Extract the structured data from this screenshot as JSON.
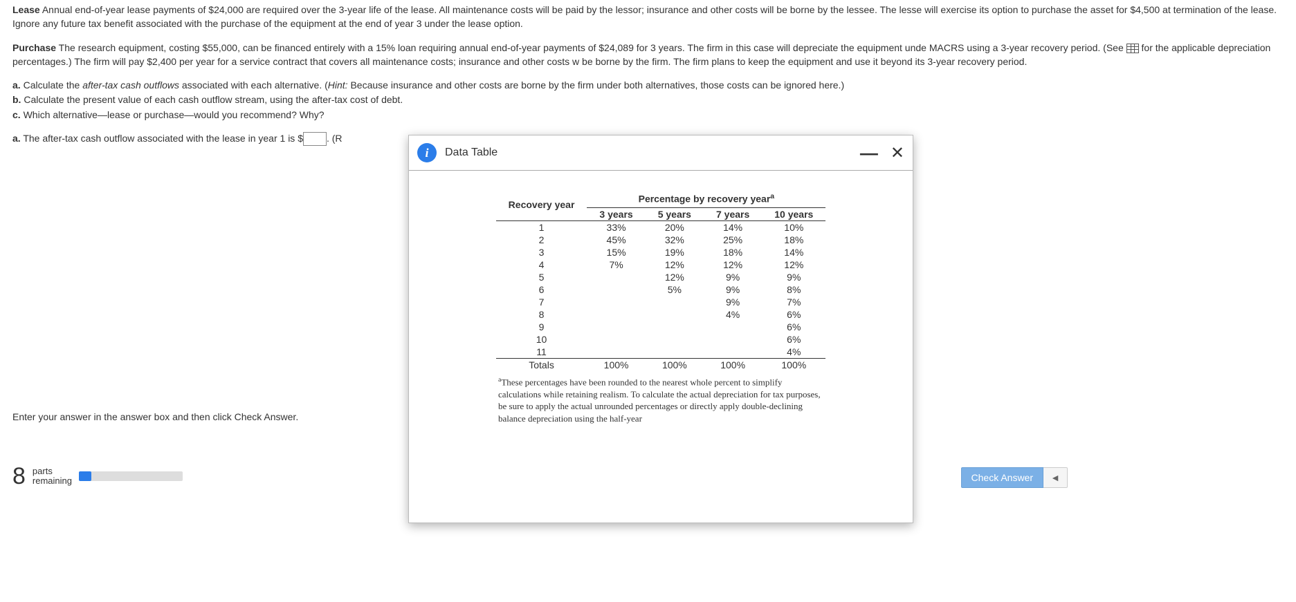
{
  "problem": {
    "lease_label": "Lease",
    "lease_text": "  Annual end-of-year lease payments of $24,000 are required over the 3-year life of the lease.  All maintenance costs will be paid by the lessor; insurance and other costs will be borne by the lessee.  The lesse will exercise its option to purchase the asset for $4,500 at termination of the lease. Ignore any future tax benefit associated with the purchase of the equipment at the end of year 3 under the lease option.",
    "purchase_label": "Purchase",
    "purchase_text_1": "  The research equipment, costing $55,000, can be financed entirely with a 15% loan requiring annual end-of-year payments of $24,089 for 3 years.  The firm in this case will depreciate the equipment unde MACRS using a 3-year recovery period.  (See ",
    "purchase_text_2": " for the applicable depreciation percentages.)  The firm will pay $2,400 per year for a service contract that covers all maintenance costs; insurance and other costs w be borne by the firm.  The firm plans to keep the equipment and use it beyond its 3-year recovery period.",
    "qa_label": "a.",
    "qa_text_1": "  Calculate the ",
    "qa_italic": "after-tax cash outflows",
    "qa_text_2": " associated with each alternative.  (",
    "qa_hint_label": "Hint:",
    "qa_text_3": " Because insurance and other costs are borne by the firm under both alternatives, those costs can be ignored here.)",
    "qb_label": "b.",
    "qb_text": "  Calculate the present value of each cash outflow stream, using the after-tax cost of debt.",
    "qc_label": "c.",
    "qc_text": "  Which alternative—lease or purchase—would you recommend?  Why?",
    "answer_a_label": "a.",
    "answer_a_text_1": "  The after-tax cash outflow associated with the lease in year 1 is $",
    "answer_a_text_2": ".  (R"
  },
  "hint": "Enter your answer in the answer box and then click Check Answer.",
  "footer": {
    "parts_num": "8",
    "parts_label_1": "parts",
    "parts_label_2": "remaining",
    "check_answer": "Check Answer"
  },
  "modal": {
    "title": "Data Table",
    "header": "Percentage by recovery year",
    "header_sup": "a",
    "recovery_label": "Recovery year",
    "columns": [
      "3 years",
      "5 years",
      "7 years",
      "10 years"
    ],
    "totals_label": "Totals",
    "footnote_sup": "a",
    "footnote": "These percentages have been rounded to the nearest whole percent to simplify calculations while retaining realism.  To calculate the actual depreciation for tax purposes, be sure to apply the actual unrounded percentages or directly apply double-declining balance depreciation using the half-year"
  },
  "chart_data": {
    "type": "table",
    "title": "Percentage by recovery year",
    "columns": [
      "Recovery year",
      "3 years",
      "5 years",
      "7 years",
      "10 years"
    ],
    "rows": [
      {
        "year": "1",
        "y3": "33%",
        "y5": "20%",
        "y7": "14%",
        "y10": "10%"
      },
      {
        "year": "2",
        "y3": "45%",
        "y5": "32%",
        "y7": "25%",
        "y10": "18%"
      },
      {
        "year": "3",
        "y3": "15%",
        "y5": "19%",
        "y7": "18%",
        "y10": "14%"
      },
      {
        "year": "4",
        "y3": "7%",
        "y5": "12%",
        "y7": "12%",
        "y10": "12%"
      },
      {
        "year": "5",
        "y3": "",
        "y5": "12%",
        "y7": "9%",
        "y10": "9%"
      },
      {
        "year": "6",
        "y3": "",
        "y5": "5%",
        "y7": "9%",
        "y10": "8%"
      },
      {
        "year": "7",
        "y3": "",
        "y5": "",
        "y7": "9%",
        "y10": "7%"
      },
      {
        "year": "8",
        "y3": "",
        "y5": "",
        "y7": "4%",
        "y10": "6%"
      },
      {
        "year": "9",
        "y3": "",
        "y5": "",
        "y7": "",
        "y10": "6%"
      },
      {
        "year": "10",
        "y3": "",
        "y5": "",
        "y7": "",
        "y10": "6%"
      },
      {
        "year": "11",
        "y3": "",
        "y5": "",
        "y7": "",
        "y10": "4%"
      }
    ],
    "totals": {
      "year": "Totals",
      "y3": "100%",
      "y5": "100%",
      "y7": "100%",
      "y10": "100%"
    }
  }
}
